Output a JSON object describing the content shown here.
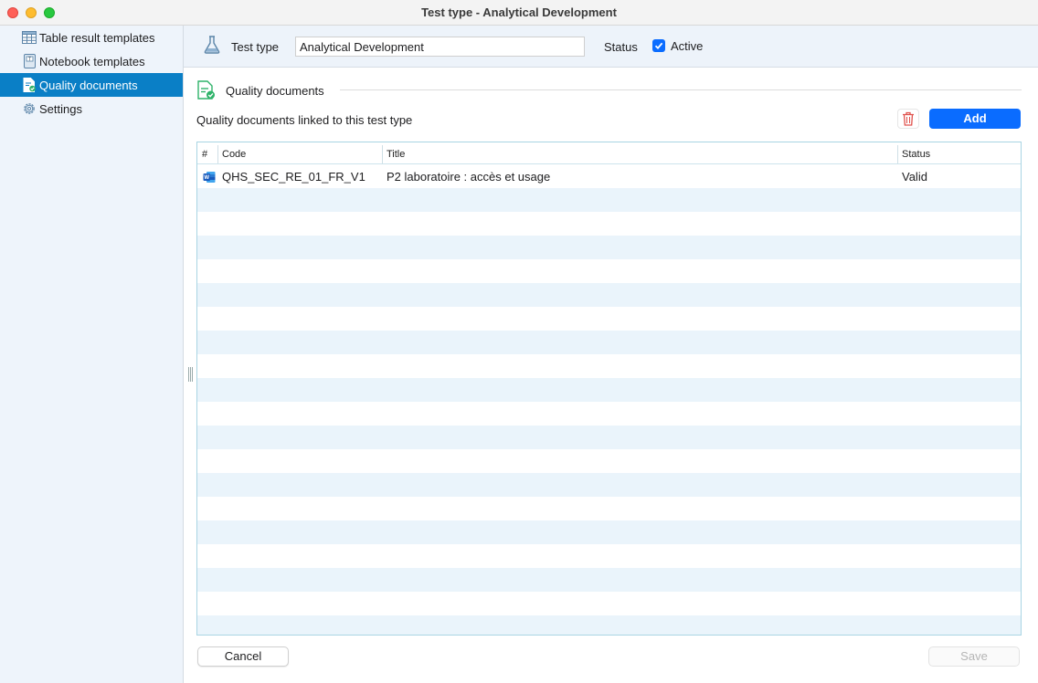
{
  "window": {
    "title": "Test type - Analytical Development"
  },
  "sidebar": {
    "items": [
      {
        "label": "Table result templates",
        "icon": "table-icon"
      },
      {
        "label": "Notebook templates",
        "icon": "notebook-icon"
      },
      {
        "label": "Quality documents",
        "icon": "quality-document-icon",
        "active": true
      },
      {
        "label": "Settings",
        "icon": "gear-icon"
      }
    ]
  },
  "header": {
    "test_type_label": "Test type",
    "test_type_value": "Analytical Development",
    "status_label": "Status",
    "active_label": "Active",
    "active_checked": true
  },
  "section": {
    "title": "Quality documents",
    "linked_label": "Quality documents linked to this test type",
    "add_label": "Add"
  },
  "table": {
    "columns": [
      "#",
      "Code",
      "Title",
      "Status"
    ],
    "rows": [
      {
        "icon": "word-document-icon",
        "code": "QHS_SEC_RE_01_FR_V1",
        "title": "P2 laboratoire : accès et usage",
        "status": "Valid"
      }
    ]
  },
  "footer": {
    "cancel_label": "Cancel",
    "save_label": "Save"
  },
  "colors": {
    "accent": "#0a6cff",
    "sidebar_active": "#0a7fc6",
    "row_stripe": "#eaf4fb"
  }
}
